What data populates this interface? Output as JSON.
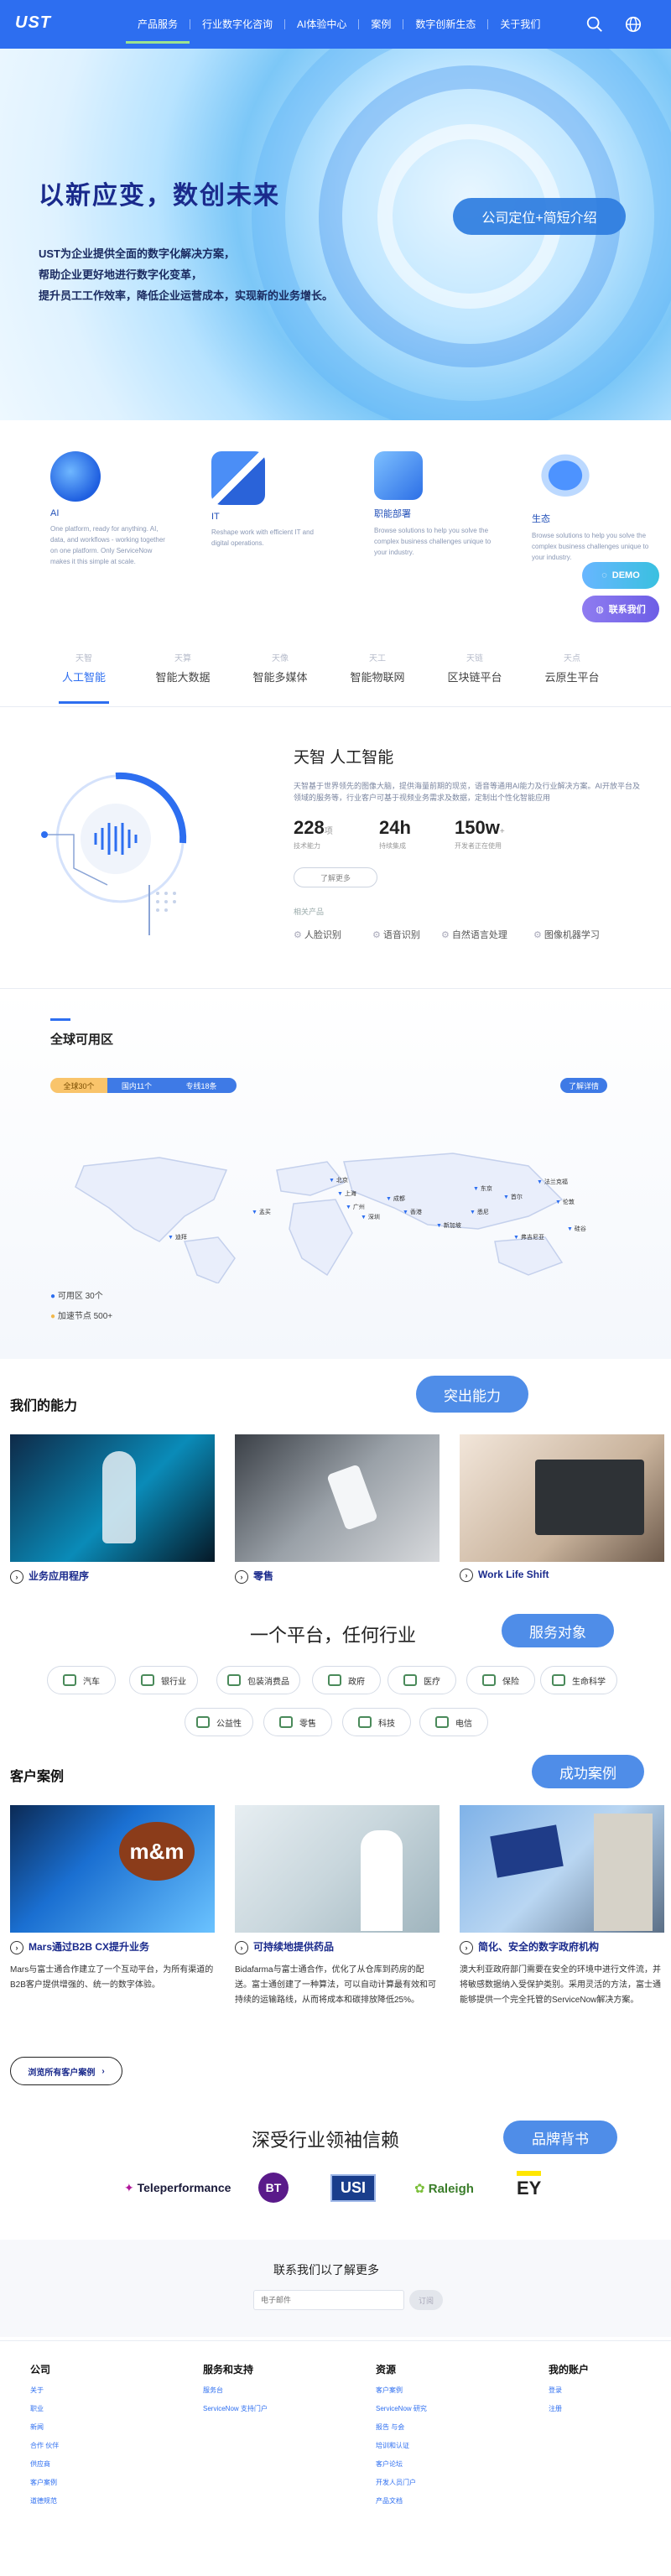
{
  "header": {
    "logo": "UST",
    "nav": [
      "产品服务",
      "行业数字化咨询",
      "AI体验中心",
      "案例",
      "数字创新生态",
      "关于我们"
    ],
    "search_icon": "search-icon",
    "globe_icon": "globe-icon"
  },
  "hero": {
    "title": "以新应变，数创未来",
    "desc": [
      "UST为企业提供全面的数字化解决方案，",
      "帮助企业更好地进行数字化变革，",
      "提升员工工作效率，降低企业运营成本，实现新的业务增长。"
    ],
    "cta": "公司定位+简短介绍"
  },
  "products": [
    {
      "title": "AI",
      "desc": "One platform, ready for anything. AI, data, and workflows - working together on one platform. Only ServiceNow makes it this simple at scale."
    },
    {
      "title": "IT",
      "desc": "Reshape work with efficient IT and digital operations."
    },
    {
      "title": "职能部署",
      "desc": "Browse solutions to help you solve the complex business challenges unique to your industry."
    },
    {
      "title": "生态",
      "desc": "Browse solutions to help you solve the complex business challenges unique to your industry."
    }
  ],
  "float": {
    "demo": "DEMO",
    "contact": "联系我们"
  },
  "tabs": [
    {
      "small": "天智",
      "label": "人工智能"
    },
    {
      "small": "天算",
      "label": "智能大数据"
    },
    {
      "small": "天像",
      "label": "智能多媒体"
    },
    {
      "small": "天工",
      "label": "智能物联网"
    },
    {
      "small": "天链",
      "label": "区块链平台"
    },
    {
      "small": "天点",
      "label": "云原生平台"
    }
  ],
  "ai": {
    "title": "天智 人工智能",
    "desc": "天智基于世界领先的图像大脑，提供海量前期的现览，语音等通用AI能力及行业解决方案。AI开放平台及领域的服务等，行业客户可基于视频业务需求及数据，定制出个性化智能应用",
    "stats": [
      {
        "num": "228",
        "unit": "项",
        "cap": "技术能力"
      },
      {
        "num": "24h",
        "unit": "",
        "cap": "持续集成"
      },
      {
        "num": "150w",
        "unit": "+",
        "cap": "开发者正在使用"
      }
    ],
    "more": "了解更多",
    "related_label": "相关产品",
    "related": [
      "人脸识别",
      "语音识别",
      "自然语言处理",
      "图像机器学习"
    ]
  },
  "global": {
    "title": "全球可用区",
    "pills": [
      "全球30个",
      "国内11个",
      "专线18条"
    ],
    "right_pill": "了解详情",
    "legend": [
      {
        "label": "可用区",
        "value": "30个"
      },
      {
        "label": "加速节点",
        "value": "500+"
      }
    ],
    "cities": [
      "北京",
      "上海",
      "广州",
      "深圳",
      "成都",
      "香港",
      "新加坡",
      "东京",
      "首尔",
      "法兰克福",
      "伦敦",
      "硅谷",
      "弗吉尼亚",
      "悉尼",
      "孟买",
      "迪拜"
    ]
  },
  "ability": {
    "title": "我们的能力",
    "button": "突出能力",
    "cards": [
      "业务应用程序",
      "零售",
      "Work Life Shift"
    ]
  },
  "industry": {
    "title": "一个平台，任何行业",
    "button": "服务对象",
    "items": [
      "汽车",
      "银行业",
      "包装消费品",
      "政府",
      "医疗",
      "保险",
      "生命科学",
      "公益性",
      "零售",
      "科技",
      "电信"
    ]
  },
  "cases": {
    "title": "客户案例",
    "button": "成功案例",
    "items": [
      {
        "title": "Mars通过B2B CX提升业务",
        "text": "Mars与富士通合作建立了一个互动平台，为所有渠道的B2B客户提供增强的、统一的数字体验。"
      },
      {
        "title": "可持续地提供药品",
        "text": "Bidafarma与富士通合作，优化了从仓库到药房的配送。富士通创建了一种算法，可以自动计算最有效和可持续的运输路线，从而将成本和碳排放降低25%。"
      },
      {
        "title": "简化、安全的数字政府机构",
        "text": "澳大利亚政府部门需要在安全的环境中进行文件流，并将敏感数据纳入受保护类别。采用灵活的方法，富士通能够提供一个完全托管的ServiceNow解决方案。"
      }
    ],
    "browse": "浏览所有客户案例"
  },
  "trust": {
    "title": "深受行业领袖信赖",
    "button": "品牌背书",
    "logos": [
      "Teleperformance",
      "BT",
      "USI",
      "Raleigh",
      "EY"
    ]
  },
  "contact": {
    "title": "联系我们以了解更多",
    "placeholder": "电子邮件",
    "submit": "订阅"
  },
  "footer": [
    {
      "head": "公司",
      "links": [
        "关于",
        "职业",
        "新闻",
        "合作 伙伴",
        "供应商",
        "客户案例",
        "道德规范"
      ]
    },
    {
      "head": "服务和支持",
      "links": [
        "服务台",
        "ServiceNow 支持门户"
      ]
    },
    {
      "head": "资源",
      "links": [
        "客户案例",
        "ServiceNow 研究",
        "报告 与会",
        "培训和认证",
        "客户论坛",
        "开发人员门户",
        "产品文档"
      ]
    },
    {
      "head": "我的账户",
      "links": [
        "登录",
        "注册"
      ]
    }
  ]
}
